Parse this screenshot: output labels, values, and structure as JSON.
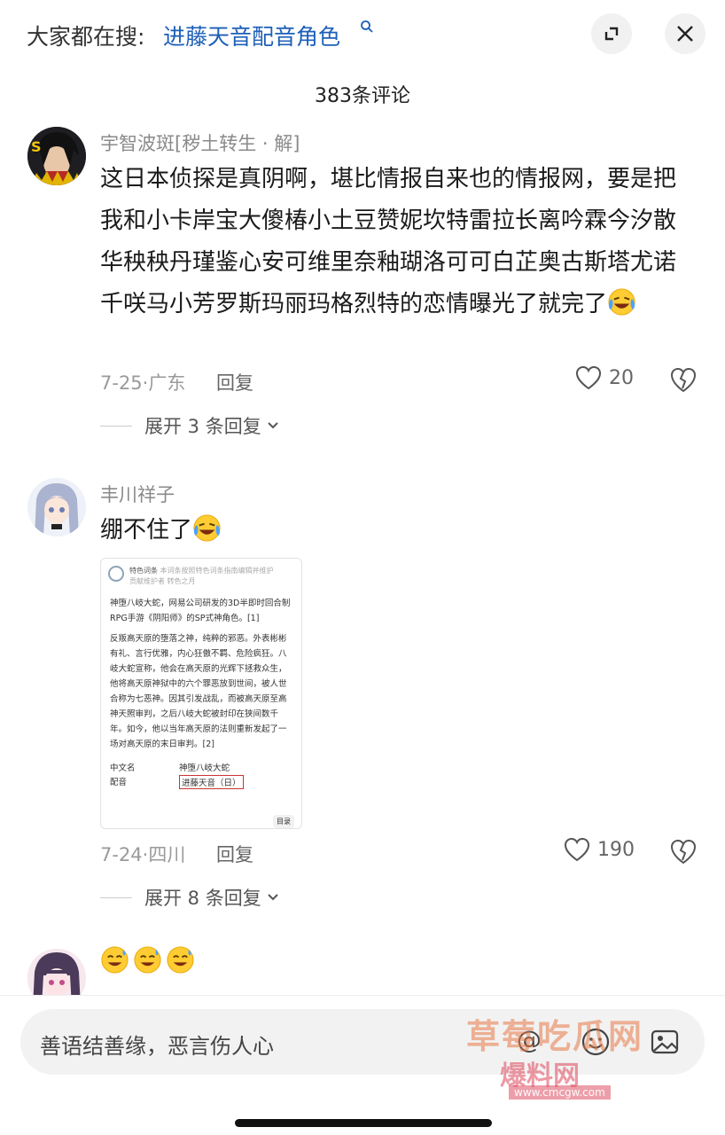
{
  "search_bar": {
    "lead": "大家都在搜:",
    "term": "进藤天音配音角色"
  },
  "comments_header": {
    "title": "383条评论"
  },
  "comments": [
    {
      "author": "宇智波斑[秽土转生 · 解]",
      "text": "这日本侦探是真阴啊，堪比情报自来也的情报网，要是把我和小卡岸宝大傻椿小土豆赞妮坎特雷拉长离吟霖今汐散华秧秧丹瑾鉴心安可维里奈釉瑚洛可可白芷奥古斯塔尤诺千咲马小芳罗斯玛丽玛格烈特的恋情曝光了就完了",
      "emoji": "laughing-crying-emoji",
      "date": "7-25",
      "location": "广东",
      "reply_label": "回复",
      "likes": "20",
      "expand_label": "展开 3 条回复"
    },
    {
      "author": "丰川祥子",
      "text": "绷不住了",
      "emoji": "laughing-crying-emoji",
      "date": "7-24",
      "location": "四川",
      "reply_label": "回复",
      "likes": "190",
      "expand_label": "展开 8 条回复",
      "image": {
        "header_title": "特色词条",
        "header_desc": "本词条按照特色词条指南编辑并维护",
        "header_maintainers": "贡献维护者",
        "header_maintainer_name": "转色之月",
        "intro": "神堕八岐大蛇，网易公司研发的3D半即时回合制RPG手游《阴阳师》的SP式神角色。[1]",
        "intro_link": "阴阳师",
        "body": "反叛高天原的堕落之神，纯粹的邪恶。外表彬彬有礼、言行优雅，内心狂傲不羁、危险疯狂。八岐大蛇宣称，他会在高天原的光辉下拯救众生，他将高天原神狱中的六个罪恶放到世间，被人世合称为七恶神。因其引发战乱，而被高天原至高神天照审判，之后八岐大蛇被封印在狭间数千年。如今，他以当年高天原的法则重新发起了一场对高天原的末日审判。[2]",
        "field_name": "中文名",
        "field_value": "神堕八岐大蛇",
        "field2_name": "配音",
        "field2_value": "进藤天音（日）",
        "toc_label": "目录"
      }
    },
    {
      "text_preview": "😅 😅 😅"
    }
  ],
  "input": {
    "placeholder": "善语结善缘，恶言伤人心",
    "at_label": "@"
  },
  "watermark": {
    "line1": "草莓吃瓜网",
    "line2": "爆料网",
    "url": "www.cmcgw.com"
  }
}
